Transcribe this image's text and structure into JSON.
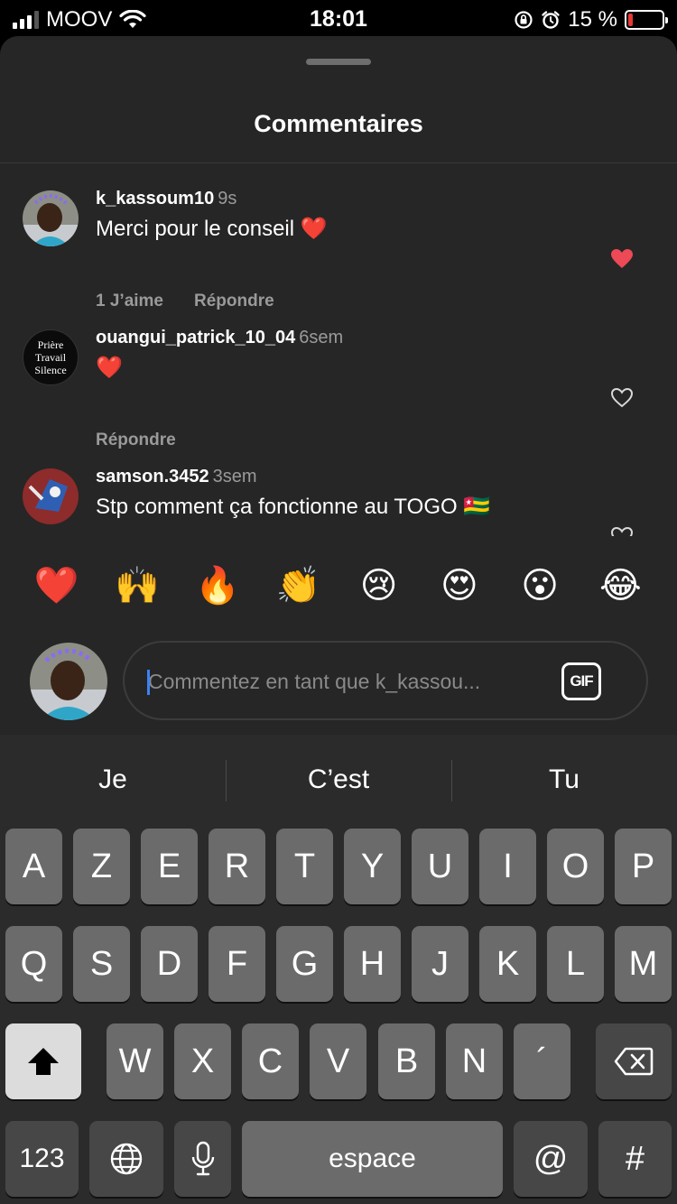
{
  "status_bar": {
    "carrier": "MOOV",
    "time": "18:01",
    "battery_percent": "15 %",
    "battery_level": 0.15
  },
  "sheet": {
    "title": "Commentaires"
  },
  "comments": [
    {
      "username": "k_kassoum10",
      "time": "9s",
      "text": "Merci pour le conseil ❤️",
      "likes": "1 J’aime",
      "reply": "Répondre",
      "liked": true
    },
    {
      "username": "ouangui_patrick_10_04",
      "time": "6sem",
      "text": "❤️",
      "reply": "Répondre",
      "liked": false,
      "avatar_text": [
        "Prière",
        "Travail",
        "Silence"
      ]
    },
    {
      "username": "samson.3452",
      "time": "3sem",
      "text": "Stp comment ça fonctionne au TOGO 🇹🇬",
      "liked": false
    }
  ],
  "emoji_bar": [
    "❤️",
    "🙌",
    "🔥",
    "👏",
    "😢",
    "😍",
    "😮",
    "😂"
  ],
  "composer": {
    "placeholder": "Commentez en tant que k_kassou...",
    "gif_label": "GIF"
  },
  "keyboard": {
    "suggestions": [
      "Je",
      "C’est",
      "Tu"
    ],
    "row1": [
      "A",
      "Z",
      "E",
      "R",
      "T",
      "Y",
      "U",
      "I",
      "O",
      "P"
    ],
    "row2": [
      "Q",
      "S",
      "D",
      "F",
      "G",
      "H",
      "J",
      "K",
      "L",
      "M"
    ],
    "row3": [
      "W",
      "X",
      "C",
      "V",
      "B",
      "N",
      "´"
    ],
    "numbers_label": "123",
    "space_label": "espace",
    "at_label": "@",
    "hash_label": "#"
  },
  "icons": {
    "shift": "shift-icon",
    "backspace": "backspace-icon",
    "globe": "globe-icon",
    "mic": "microphone-icon",
    "like": "heart-icon"
  },
  "colors": {
    "sheet_bg": "#262626",
    "like_red": "#ed4956",
    "cursor_blue": "#3b82f6"
  }
}
